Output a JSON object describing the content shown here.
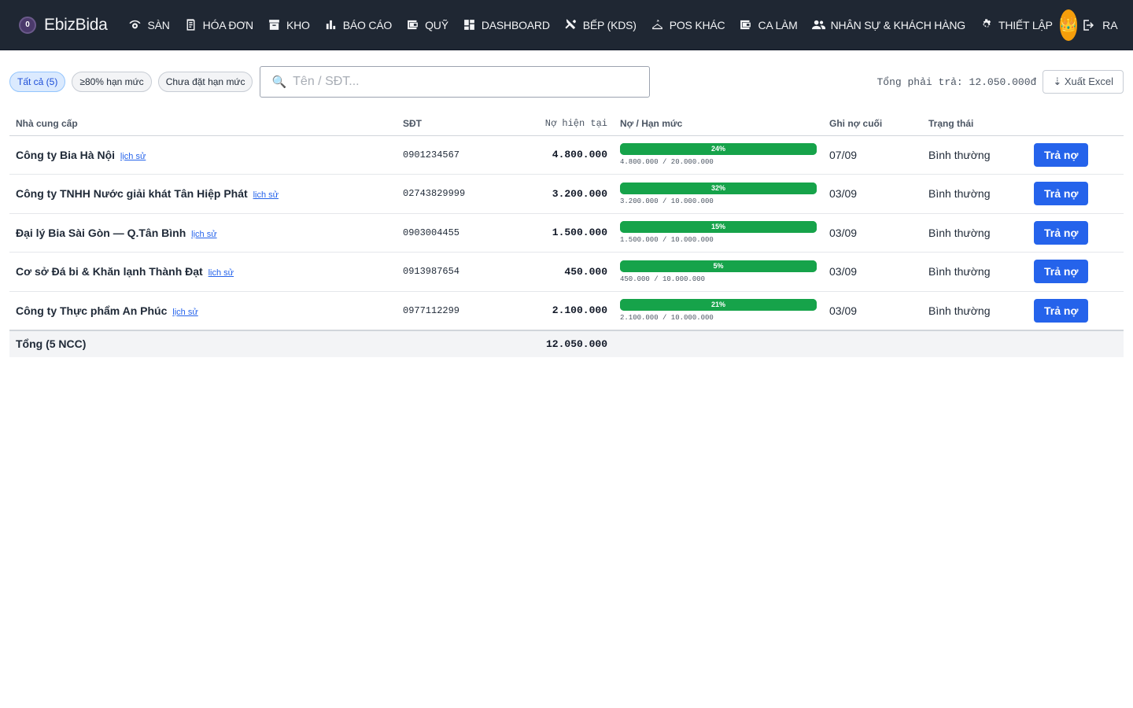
{
  "brand": {
    "logo_text": "0",
    "name": "EbizBida"
  },
  "nav": [
    {
      "label": "SÀN",
      "icon": "eye-icon"
    },
    {
      "label": "HÓA ĐƠN",
      "icon": "receipt-icon"
    },
    {
      "label": "KHO",
      "icon": "archive-icon"
    },
    {
      "label": "BÁO CÁO",
      "icon": "bar-chart-icon"
    },
    {
      "label": "QUỸ",
      "icon": "wallet-icon"
    },
    {
      "label": "DASHBOARD",
      "icon": "dashboard-icon"
    },
    {
      "label": "BẾP (KDS)",
      "icon": "utensils-icon"
    },
    {
      "label": "POS KHÁC",
      "icon": "hanger-icon"
    },
    {
      "label": "CA LÀM",
      "icon": "wallet-icon"
    },
    {
      "label": "NHÂN SỰ & KHÁCH HÀNG",
      "icon": "people-icon"
    },
    {
      "label": "THIẾT LẬP",
      "icon": "gear-icon"
    }
  ],
  "avatar": {
    "glyph": "👑"
  },
  "logout": {
    "label": "RA"
  },
  "filters": {
    "chips": [
      {
        "label": "Tất cả (5)",
        "active": true
      },
      {
        "label": "≥80% hạn mức",
        "active": false
      },
      {
        "label": "Chưa đặt hạn mức",
        "active": false
      }
    ],
    "search_placeholder": "Tên / SĐT...",
    "search_value": ""
  },
  "summary": {
    "total_label": "Tổng phải trả: 12.050.000đ",
    "export_label": "⇣ Xuất Excel"
  },
  "table": {
    "headers": {
      "supplier": "Nhà cung cấp",
      "phone": "SĐT",
      "debt": "Nợ hiện tại",
      "limit": "Nợ / Hạn mức",
      "last": "Ghi nợ cuối",
      "status": "Trạng thái"
    },
    "history_label": "lịch sử",
    "pay_label": "Trả nợ",
    "rows": [
      {
        "name": "Công ty Bia Hà Nội",
        "phone": "0901234567",
        "debt": "4.800.000",
        "pct": 24,
        "pct_label": "24%",
        "ratio": "4.800.000 / 20.000.000",
        "last": "07/09",
        "status": "Bình thường"
      },
      {
        "name": "Công ty TNHH Nước giải khát Tân Hiệp Phát",
        "phone": "02743829999",
        "debt": "3.200.000",
        "pct": 32,
        "pct_label": "32%",
        "ratio": "3.200.000 / 10.000.000",
        "last": "03/09",
        "status": "Bình thường"
      },
      {
        "name": "Đại lý Bia Sài Gòn — Q.Tân Bình",
        "phone": "0903004455",
        "debt": "1.500.000",
        "pct": 15,
        "pct_label": "15%",
        "ratio": "1.500.000 / 10.000.000",
        "last": "03/09",
        "status": "Bình thường"
      },
      {
        "name": "Cơ sở Đá bi & Khăn lạnh Thành Đạt",
        "phone": "0913987654",
        "debt": "450.000",
        "pct": 5,
        "pct_label": "5%",
        "ratio": "450.000 / 10.000.000",
        "last": "03/09",
        "status": "Bình thường"
      },
      {
        "name": "Công ty Thực phẩm An Phúc",
        "phone": "0977112299",
        "debt": "2.100.000",
        "pct": 21,
        "pct_label": "21%",
        "ratio": "2.100.000 / 10.000.000",
        "last": "03/09",
        "status": "Bình thường"
      }
    ],
    "total": {
      "label": "Tổng (5 NCC)",
      "debt": "12.050.000"
    }
  },
  "colors": {
    "nav_bg": "#1f2733",
    "accent": "#2563eb",
    "bar": "#16a34a",
    "avatar": "#f59e0b"
  }
}
